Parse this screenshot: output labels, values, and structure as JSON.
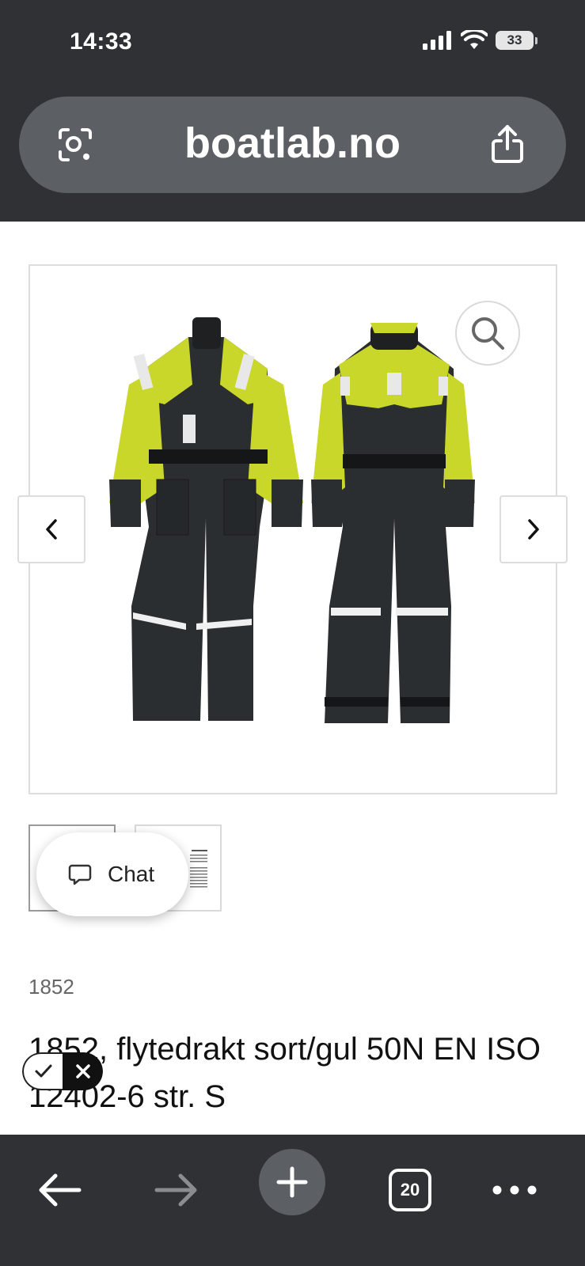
{
  "status_bar": {
    "time": "14:33",
    "battery": "33",
    "icons": [
      "signal-icon",
      "wifi-icon",
      "battery-icon"
    ]
  },
  "browser": {
    "url": "boatlab.no",
    "tab_count": "20",
    "icons": [
      "camera-search-icon",
      "share-icon",
      "back-arrow-icon",
      "forward-arrow-icon",
      "new-tab-plus-icon",
      "tabs-icon",
      "more-icon"
    ]
  },
  "product": {
    "sku": "1852",
    "title": "1852, flytedrakt sort/gul 50N EN ISO 12402-6 str. S",
    "image_alt": "Flytedrakt sort/gul front and back",
    "thumbnails": [
      "front-back",
      "size-chart"
    ]
  },
  "chat": {
    "label": "Chat"
  },
  "colors": {
    "chrome_bg": "#2f3135",
    "urlbar_bg": "#5c5f64",
    "suit_black": "#2b2e31",
    "suit_yellow": "#c9d62a"
  }
}
